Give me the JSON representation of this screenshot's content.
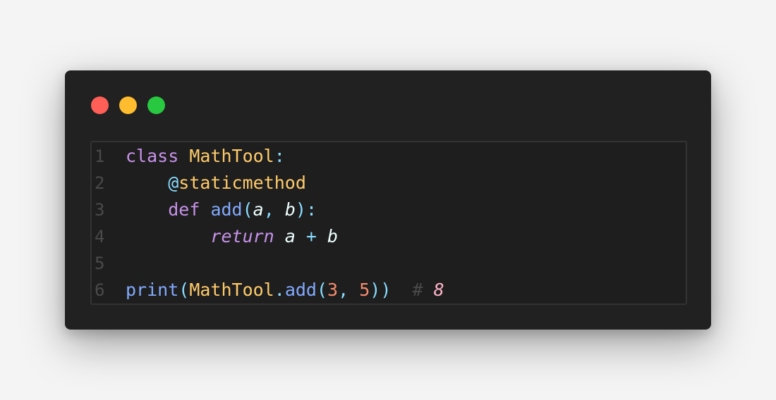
{
  "window": {
    "traffic_lights": [
      {
        "name": "close",
        "color": "#ff5f57"
      },
      {
        "name": "minimize",
        "color": "#febc2e"
      },
      {
        "name": "maximize",
        "color": "#28c840"
      }
    ]
  },
  "editor": {
    "language": "python",
    "colors": {
      "keyword": "#c792ea",
      "class_name": "#ffcb6b",
      "decorator": "#ffcb6b",
      "function": "#82aaff",
      "punctuation": "#89ddff",
      "param": "#eeffff",
      "number": "#f78c6c",
      "comment": "#4a4a4a",
      "comment_value": "#ffb3c8",
      "line_number": "#4a4a4a"
    },
    "lines": [
      {
        "number": "1",
        "tokens": [
          {
            "text": "class",
            "type": "keyword"
          },
          {
            "text": " ",
            "type": "space"
          },
          {
            "text": "MathTool",
            "type": "class_name"
          },
          {
            "text": ":",
            "type": "punctuation"
          }
        ]
      },
      {
        "number": "2",
        "tokens": [
          {
            "text": "    ",
            "type": "space"
          },
          {
            "text": "@",
            "type": "punctuation"
          },
          {
            "text": "staticmethod",
            "type": "decorator"
          }
        ]
      },
      {
        "number": "3",
        "tokens": [
          {
            "text": "    ",
            "type": "space"
          },
          {
            "text": "def",
            "type": "keyword"
          },
          {
            "text": " ",
            "type": "space"
          },
          {
            "text": "add",
            "type": "function"
          },
          {
            "text": "(",
            "type": "punctuation"
          },
          {
            "text": "a",
            "type": "param_italic"
          },
          {
            "text": ", ",
            "type": "punctuation"
          },
          {
            "text": "b",
            "type": "param_italic"
          },
          {
            "text": "):",
            "type": "punctuation"
          }
        ]
      },
      {
        "number": "4",
        "tokens": [
          {
            "text": "        ",
            "type": "space"
          },
          {
            "text": "return",
            "type": "keyword_italic"
          },
          {
            "text": " ",
            "type": "space"
          },
          {
            "text": "a",
            "type": "param_italic"
          },
          {
            "text": " + ",
            "type": "punctuation"
          },
          {
            "text": "b",
            "type": "param_italic"
          }
        ]
      },
      {
        "number": "5",
        "tokens": []
      },
      {
        "number": "6",
        "tokens": [
          {
            "text": "print",
            "type": "function"
          },
          {
            "text": "(",
            "type": "punctuation"
          },
          {
            "text": "MathTool",
            "type": "class_name"
          },
          {
            "text": ".",
            "type": "punctuation"
          },
          {
            "text": "add",
            "type": "function"
          },
          {
            "text": "(",
            "type": "punctuation"
          },
          {
            "text": "3",
            "type": "number"
          },
          {
            "text": ", ",
            "type": "punctuation"
          },
          {
            "text": "5",
            "type": "number"
          },
          {
            "text": "))",
            "type": "punctuation"
          },
          {
            "text": "  ",
            "type": "space"
          },
          {
            "text": "#",
            "type": "comment"
          },
          {
            "text": " ",
            "type": "space"
          },
          {
            "text": "8",
            "type": "comment_value"
          }
        ]
      }
    ]
  }
}
